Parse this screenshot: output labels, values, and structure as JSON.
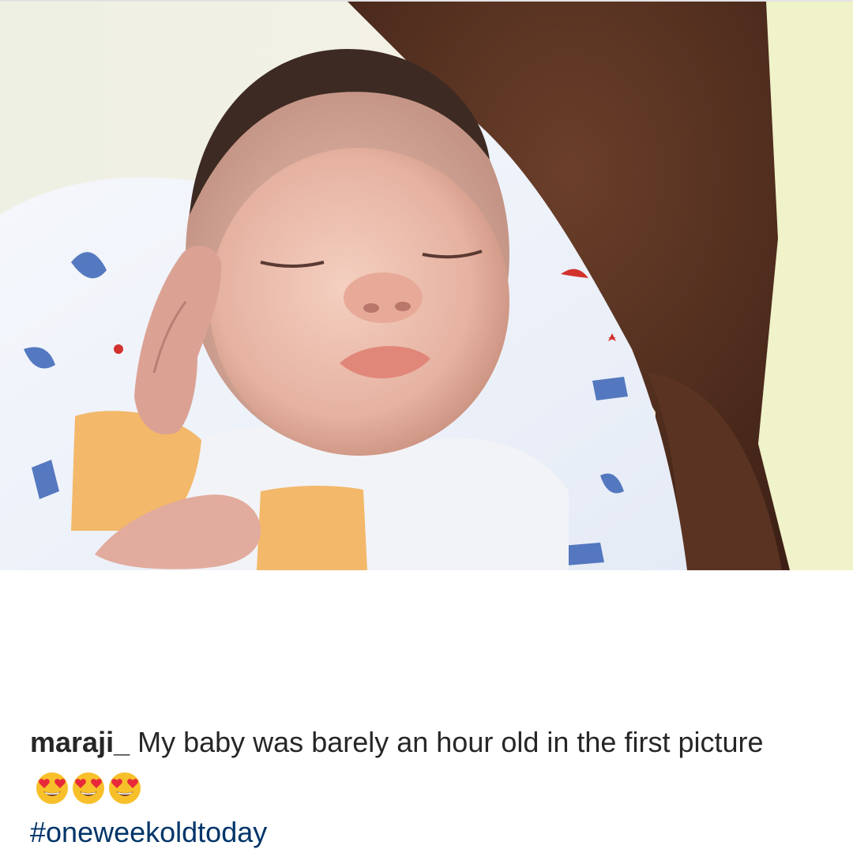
{
  "post": {
    "photo": {
      "alt_icon": "sleeping-newborn-photo"
    },
    "caption": {
      "username": "maraji_",
      "text": "My baby was barely an hour old in the first picture",
      "emoji_icon": "heart-eyes-emoji",
      "emoji_count": 3,
      "hashtag": "#oneweekoldtoday"
    }
  },
  "colors": {
    "username": "#262626",
    "hashtag": "#003569",
    "background": "#ffffff"
  }
}
